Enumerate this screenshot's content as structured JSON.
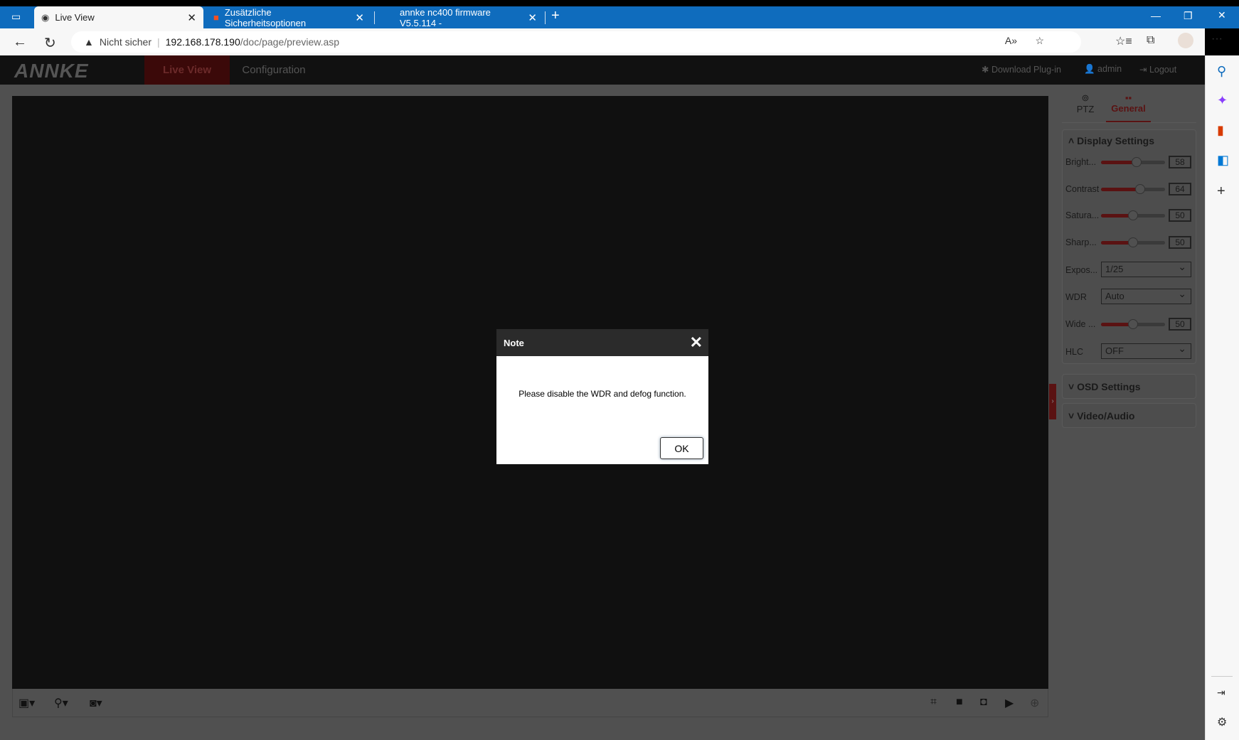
{
  "browser": {
    "tabs": [
      {
        "label": "Live View",
        "active": true
      },
      {
        "label": "Zusätzliche Sicherheitsoptionen",
        "active": false
      },
      {
        "label": "annke nc400 firmware V5.5.114 -",
        "active": false
      }
    ],
    "security_label": "Nicht sicher",
    "url_host": "192.168.178.190",
    "url_path": "/doc/page/preview.asp"
  },
  "app": {
    "logo": "ANNKE",
    "nav": [
      "Live View",
      "Configuration"
    ],
    "header_links": {
      "download": "Download Plug-in",
      "user": "admin",
      "logout": "Logout"
    },
    "panel_tabs": [
      "PTZ",
      "General"
    ],
    "display_settings": {
      "title": "Display Settings",
      "sliders": [
        {
          "label": "Bright...",
          "value": 58
        },
        {
          "label": "Contrast",
          "value": 64
        },
        {
          "label": "Satura...",
          "value": 50
        },
        {
          "label": "Sharp...",
          "value": 50
        }
      ],
      "exposure": {
        "label": "Expos...",
        "value": "1/25"
      },
      "wdr": {
        "label": "WDR",
        "value": "Auto"
      },
      "wide": {
        "label": "Wide ...",
        "value": 50
      },
      "hlc": {
        "label": "HLC",
        "value": "OFF"
      }
    },
    "osd_title": "OSD Settings",
    "video_audio_title": "Video/Audio"
  },
  "dialog": {
    "title": "Note",
    "message": "Please disable the WDR and defog function.",
    "ok": "OK"
  },
  "colors": {
    "accent": "#8b1a1a",
    "edge_blue": "#0f6cbd"
  }
}
